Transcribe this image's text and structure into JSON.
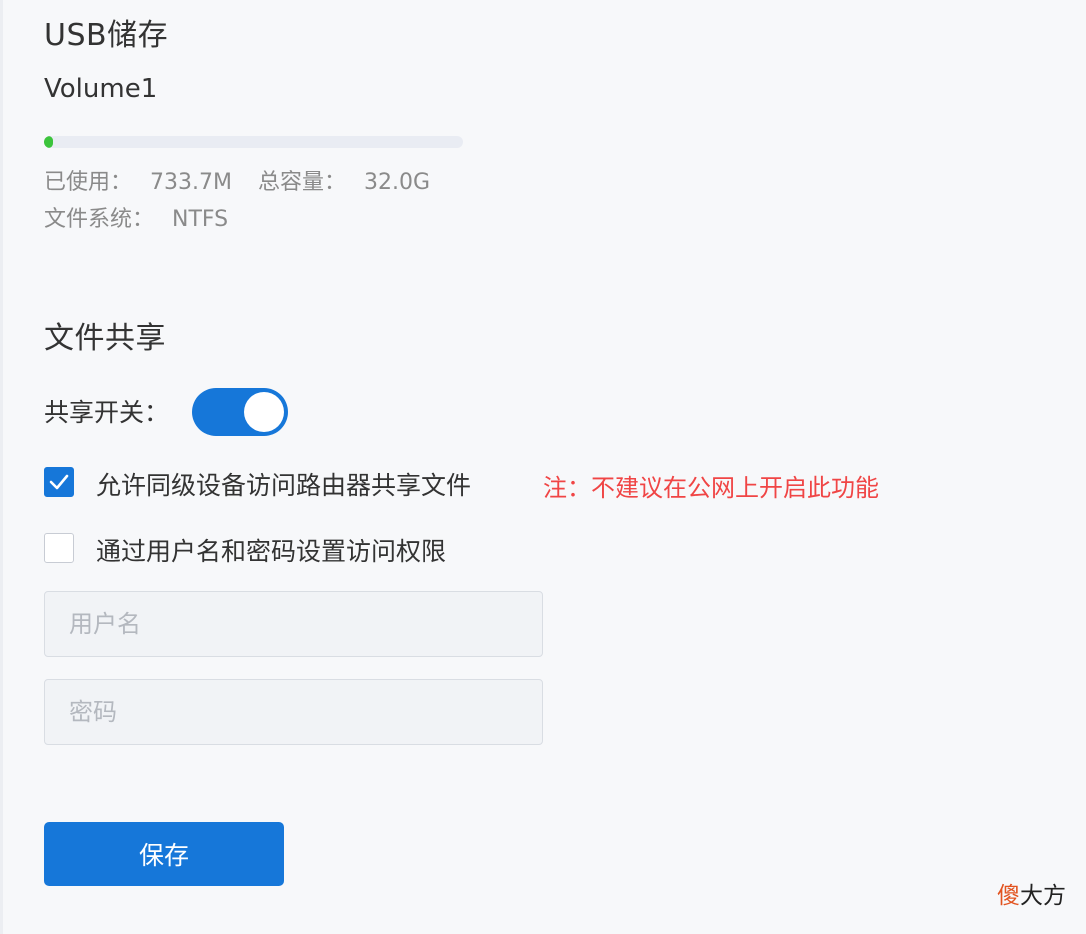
{
  "usb": {
    "title": "USB储存",
    "volume_name": "Volume1",
    "usage_fraction": 0.022,
    "used_label": "已使用：",
    "used_value": "733.7M",
    "capacity_label": "总容量：",
    "capacity_value": "32.0G",
    "fs_label": "文件系统：",
    "fs_value": "NTFS"
  },
  "sharing": {
    "title": "文件共享",
    "toggle_label": "共享开关：",
    "toggle_on": true,
    "allow_lan_label": "允许同级设备访问路由器共享文件",
    "allow_lan_checked": true,
    "note": "注：不建议在公网上开启此功能",
    "auth_label": "通过用户名和密码设置访问权限",
    "auth_checked": false,
    "username_placeholder": "用户名",
    "password_placeholder": "密码"
  },
  "actions": {
    "save_label": "保存"
  },
  "watermark": {
    "part1": "傻",
    "part2": "大方"
  },
  "colors": {
    "accent": "#1677d9",
    "progress": "#3cc43c",
    "warning": "#f04545",
    "background": "#f7f8fa"
  }
}
